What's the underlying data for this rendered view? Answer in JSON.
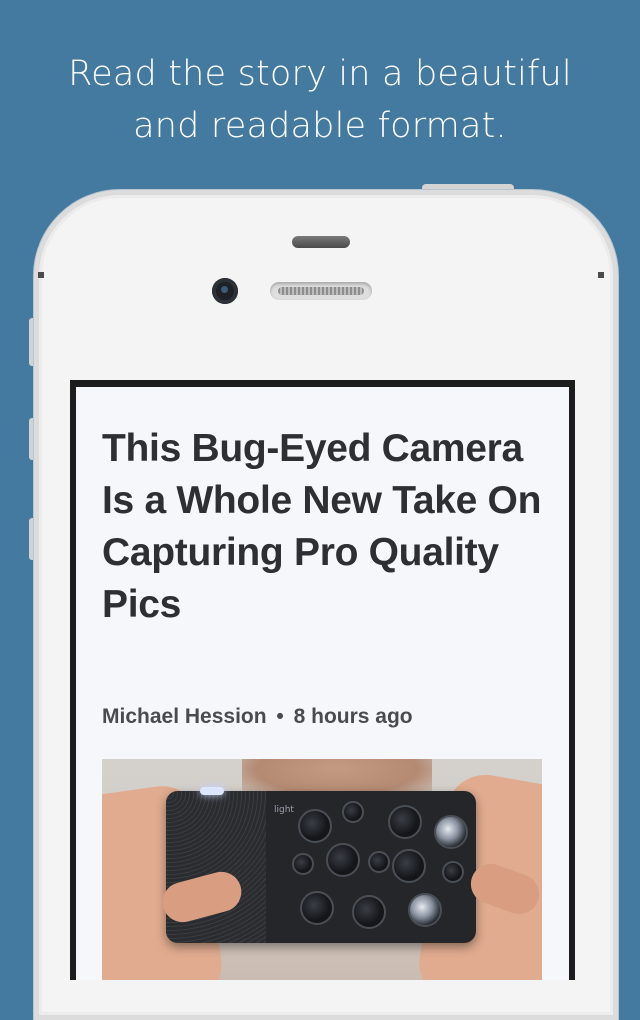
{
  "promo": {
    "tagline_line1": "Read the story in a beautiful",
    "tagline_line2": "and readable format."
  },
  "article": {
    "title": "This Bug-Eyed Camera Is a Whole New Take On Capturing Pro Quality Pics",
    "author": "Michael Hession",
    "separator": "•",
    "time": "8 hours ago",
    "image_brand_text": "light"
  },
  "colors": {
    "background": "#457aa0",
    "screen_background": "#f6f7fb",
    "title_text": "#2e2f33"
  }
}
